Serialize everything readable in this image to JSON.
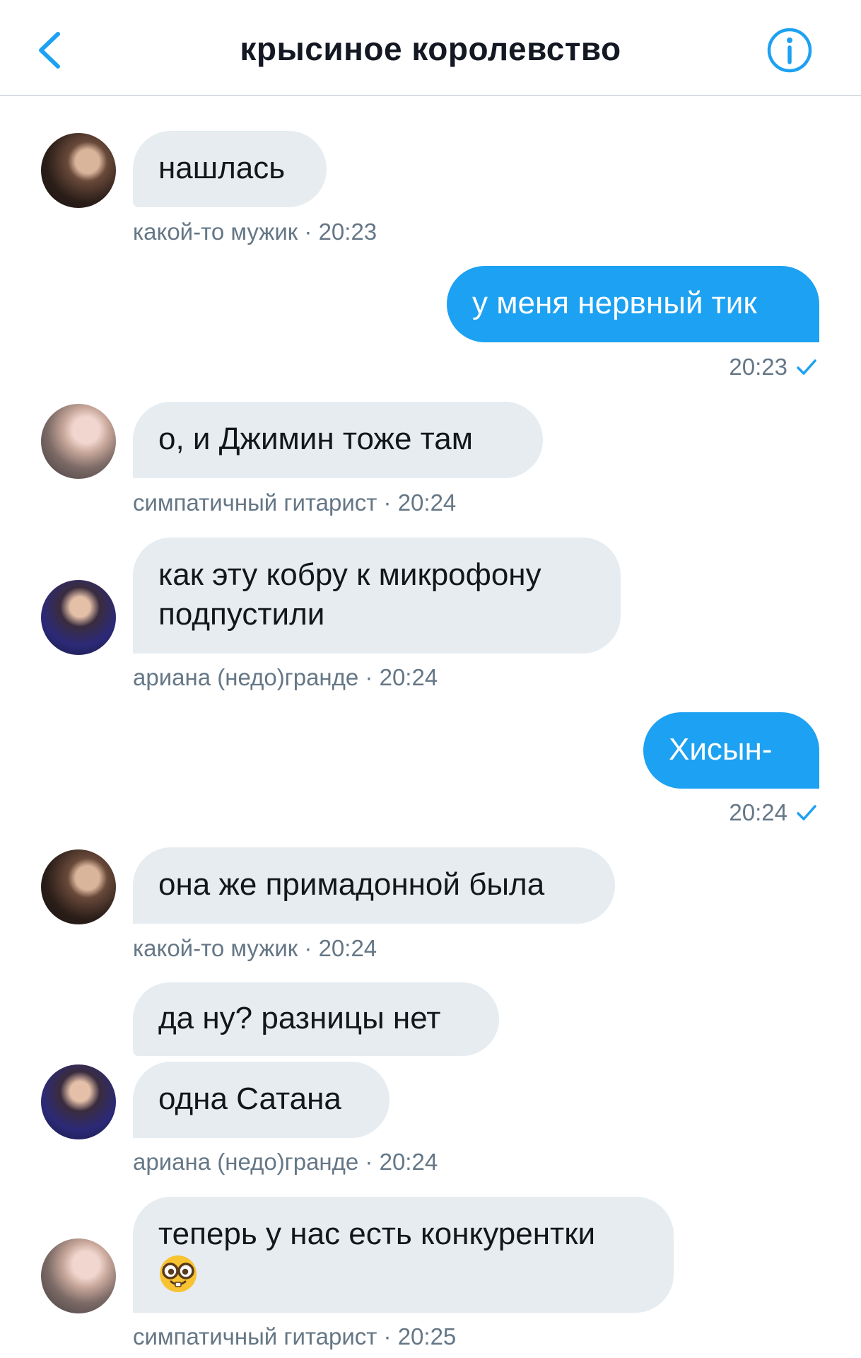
{
  "header": {
    "title": "крысиное королевство",
    "back_icon": "chevron-left-icon",
    "info_icon": "info-icon",
    "accent_color": "#1da1f2"
  },
  "messages": [
    {
      "direction": "incoming",
      "lines": [
        "нашлась"
      ],
      "sender": "какой-то мужик",
      "time": "20:23",
      "avatar": "avatar-person-a"
    },
    {
      "direction": "outgoing",
      "lines": [
        "у меня нервный тик"
      ],
      "time": "20:23",
      "status_icon": "checkmark-icon"
    },
    {
      "direction": "incoming",
      "lines": [
        "о, и Джимин тоже там"
      ],
      "sender": "симпатичный гитарист",
      "time": "20:24",
      "avatar": "avatar-person-b"
    },
    {
      "direction": "incoming",
      "lines": [
        "как эту кобру к микрофону подпустили"
      ],
      "sender": "ариана (недо)гранде ",
      "time": "20:24",
      "avatar": "avatar-person-c"
    },
    {
      "direction": "outgoing",
      "lines": [
        "Хисын-"
      ],
      "time": "20:24",
      "status_icon": "checkmark-icon"
    },
    {
      "direction": "incoming",
      "lines": [
        "она же примадонной была"
      ],
      "sender": "какой-то мужик",
      "time": "20:24",
      "avatar": "avatar-person-a"
    },
    {
      "direction": "incoming",
      "lines": [
        "да ну? разницы нет",
        "одна Сатана"
      ],
      "sender": "ариана (недо)гранде ",
      "time": "20:24",
      "avatar": "avatar-person-c"
    },
    {
      "direction": "incoming",
      "lines": [
        "теперь у нас есть конкурентки"
      ],
      "emoji": "nerd-face-emoji",
      "sender": "симпатичный гитарист",
      "time": "20:25",
      "avatar": "avatar-person-b"
    }
  ]
}
